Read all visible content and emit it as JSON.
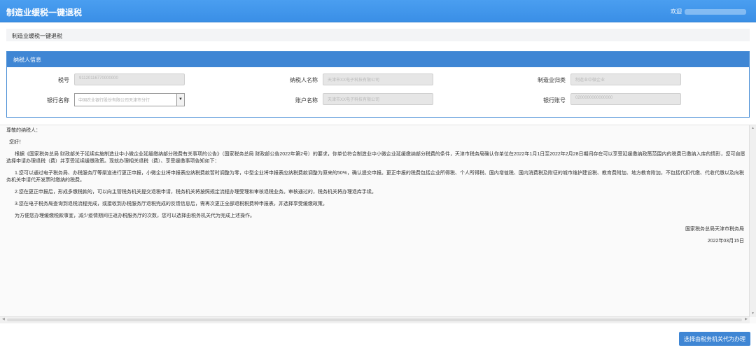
{
  "header": {
    "title": "制造业缓税一键退税",
    "welcome_label": "欢迎"
  },
  "breadcrumb": {
    "text": "制造业缓税一键退税"
  },
  "taxpayer_panel": {
    "title": "纳税人信息",
    "fields": {
      "tax_id": {
        "label": "税号",
        "value": "91120116770000000"
      },
      "taxpayer_name": {
        "label": "纳税人名称",
        "value": "天津市XX电子科技有限公司"
      },
      "manufacturing_category": {
        "label": "制造业归类",
        "value": "制造业中微企业"
      },
      "bank_name": {
        "label": "银行名称",
        "value": "中国农业银行股份有限公司天津市分行"
      },
      "account_name": {
        "label": "账户名称",
        "value": "天津市XX电子科技有限公司"
      },
      "bank_account": {
        "label": "银行账号",
        "value": "0200000000000000"
      }
    }
  },
  "notice": {
    "salutation": "尊敬的纳税人：",
    "greeting": "您好！",
    "paragraphs": [
      "根据《国家税务总局 财政部关于延续实施制造业中小微企业延缓缴纳部分税费有关事项的公告》（国家税务总局 财政部公告2022年第2号）的要求，你单位符合制造业中小微企业延缓缴纳部分税费的条件，天津市税务局确认你单位在2022年1月1日至2022年2月28日期间存在可以享受延缓缴纳政策范围内的税费已缴纳入库的情形，您可自愿选择申请办理退税（费）并享受延续缓缴政策。现就办理相关退税（费）、享受缓缴事项告知如下：",
      "1.您可以通过电子税务局、办税服务厅等渠道进行更正申报，小微企业将申报表应纳税费款暂时调整为零，中型企业将申报表应纳税费款调整为原来的50%，确认提交申报。更正申报的税费包括企业所得税、个人所得税、国内增值税、国内消费税及附征的城市维护建设税、教育费附加、地方教育附加，不包括代扣代缴、代收代缴以及向税务机关申请代开发票时缴纳的税费。",
      "2.您在更正申报后，形成多缴税款的，可以向主管税务机关提交退税申请，税务机关将按照规定流程办理受理和审核退税业务。审核通过的，税务机关将办理退库手续。",
      "3.您在电子税务局查询到退税流程完成，或接收到办税服务厅退税完成的反馈信息后，需再次更正全部退税税费种申报表，并选择享受缓缴政策。",
      "为方便您办理缓缴税款事宜，减少疫情期间往返办税服务厅的次数，您可以选择由税务机关代为完成上述操作。"
    ],
    "signature": "国家税务总局天津市税务局",
    "date": "2022年03月15日"
  },
  "actions": {
    "delegate_button": "选择由税务机关代为办理"
  }
}
